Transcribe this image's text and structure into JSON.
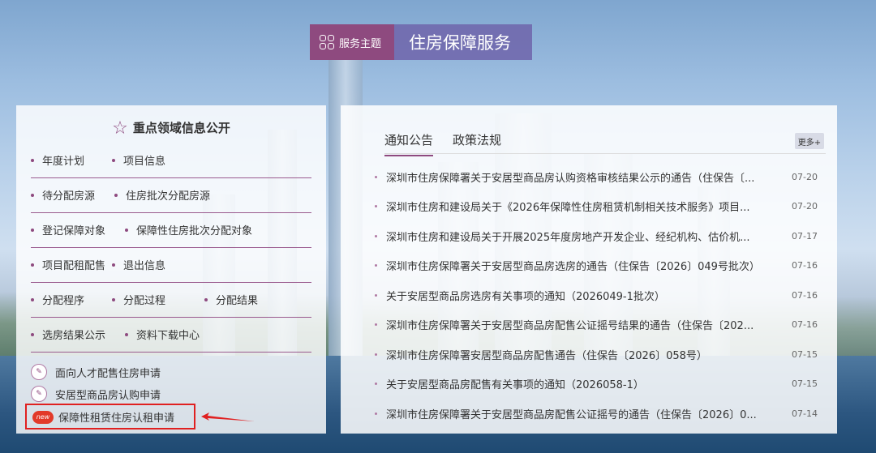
{
  "header": {
    "tag_label": "服务主题",
    "title": "住房保障服务",
    "icon": "grid-icon"
  },
  "left": {
    "title": "重点领域信息公开",
    "title_icon": "star-icon",
    "rows": [
      [
        "年度计划",
        "项目信息"
      ],
      [
        "待分配房源",
        "住房批次分配房源"
      ],
      [
        "登记保障对象",
        "保障性住房批次分配对象"
      ],
      [
        "项目配租配售",
        "退出信息"
      ],
      [
        "分配程序",
        "分配过程",
        "分配结果"
      ],
      [
        "选房结果公示",
        "资料下载中心"
      ]
    ],
    "applications": [
      {
        "label": "面向人才配售住房申请",
        "icon": "apply-icon"
      },
      {
        "label": "安居型商品房认购申请",
        "icon": "apply-icon"
      },
      {
        "label": "保障性租赁住房认租申请",
        "icon": "new-icon",
        "badge": "new"
      }
    ]
  },
  "right": {
    "tabs": [
      "通知公告",
      "政策法规"
    ],
    "active_tab": "通知公告",
    "more_label": "更多+",
    "news": [
      {
        "title": "深圳市住房保障署关于安居型商品房认购资格审核结果公示的通告（住保告〔...",
        "date": "07-20"
      },
      {
        "title": "深圳市住房和建设局关于《2026年保障性住房租赁机制相关技术服务》项目...",
        "date": "07-20"
      },
      {
        "title": "深圳市住房和建设局关于开展2025年度房地产开发企业、经纪机构、估价机...",
        "date": "07-17"
      },
      {
        "title": "深圳市住房保障署关于安居型商品房选房的通告（住保告〔2026〕049号批次）",
        "date": "07-16"
      },
      {
        "title": "关于安居型商品房选房有关事项的通知（2026049-1批次）",
        "date": "07-16"
      },
      {
        "title": "深圳市住房保障署关于安居型商品房配售公证摇号结果的通告（住保告〔202...",
        "date": "07-16"
      },
      {
        "title": "深圳市住房保障署安居型商品房配售通告（住保告〔2026〕058号）",
        "date": "07-15"
      },
      {
        "title": "关于安居型商品房配售有关事项的通知（2026058-1）",
        "date": "07-15"
      },
      {
        "title": "深圳市住房保障署关于安居型商品房配售公证摇号的通告（住保告〔2026〕0...",
        "date": "07-14"
      }
    ]
  },
  "colors": {
    "accent": "#8e4a7f",
    "title_bg": "#6e64aa",
    "highlight": "#e02020"
  }
}
